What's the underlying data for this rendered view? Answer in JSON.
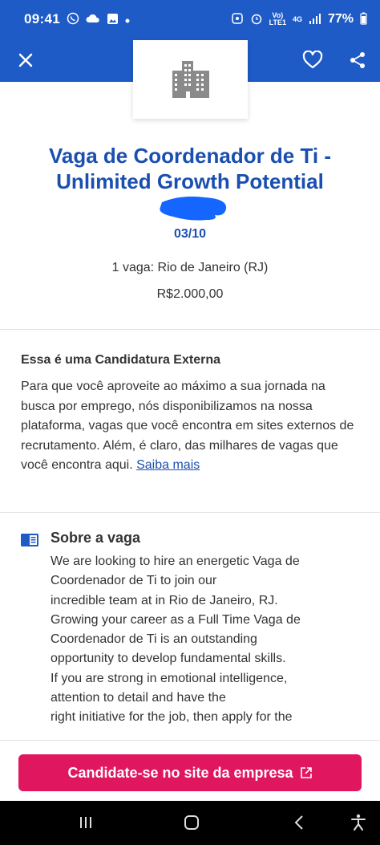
{
  "status_bar": {
    "time": "09:41",
    "signal_text_top": "Vo)",
    "signal_text_bottom": "LTE1",
    "network": "4G",
    "battery": "77%"
  },
  "app_bar": {
    "close_icon": "close-icon",
    "favorite_icon": "heart-outline-icon",
    "share_icon": "share-icon",
    "logo_icon": "building-icon"
  },
  "job": {
    "title": "Vaga de Coordenador de Ti - Unlimited Growth Potential",
    "date": "03/10",
    "location": "1 vaga: Rio de Janeiro (RJ)",
    "salary": "R$2.000,00"
  },
  "external": {
    "title": "Essa é uma Candidatura Externa",
    "text": "Para que você aproveite ao máximo a sua jornada na busca por emprego, nós disponibilizamos na nossa plataforma, vagas que você encontra em sites externos de recrutamento. Além, é claro, das milhares de vagas que você encontra aqui. ",
    "link": "Saiba mais"
  },
  "about": {
    "title": "Sobre a vaga",
    "text": "We are looking to hire an energetic Vaga de\nCoordenador de Ti to join our\nincredible team at in Rio de Janeiro, RJ.\nGrowing your career as a Full Time Vaga de\nCoordenador de Ti is an outstanding\nopportunity to develop fundamental skills.\nIf you are strong in emotional intelligence,\nattention to detail and have the\nright initiative for the job, then apply for the"
  },
  "cta": {
    "label": "Candidate-se no site da empresa"
  },
  "colors": {
    "primary": "#1e5bc6",
    "title": "#1a4fb0",
    "cta": "#e0165e"
  }
}
